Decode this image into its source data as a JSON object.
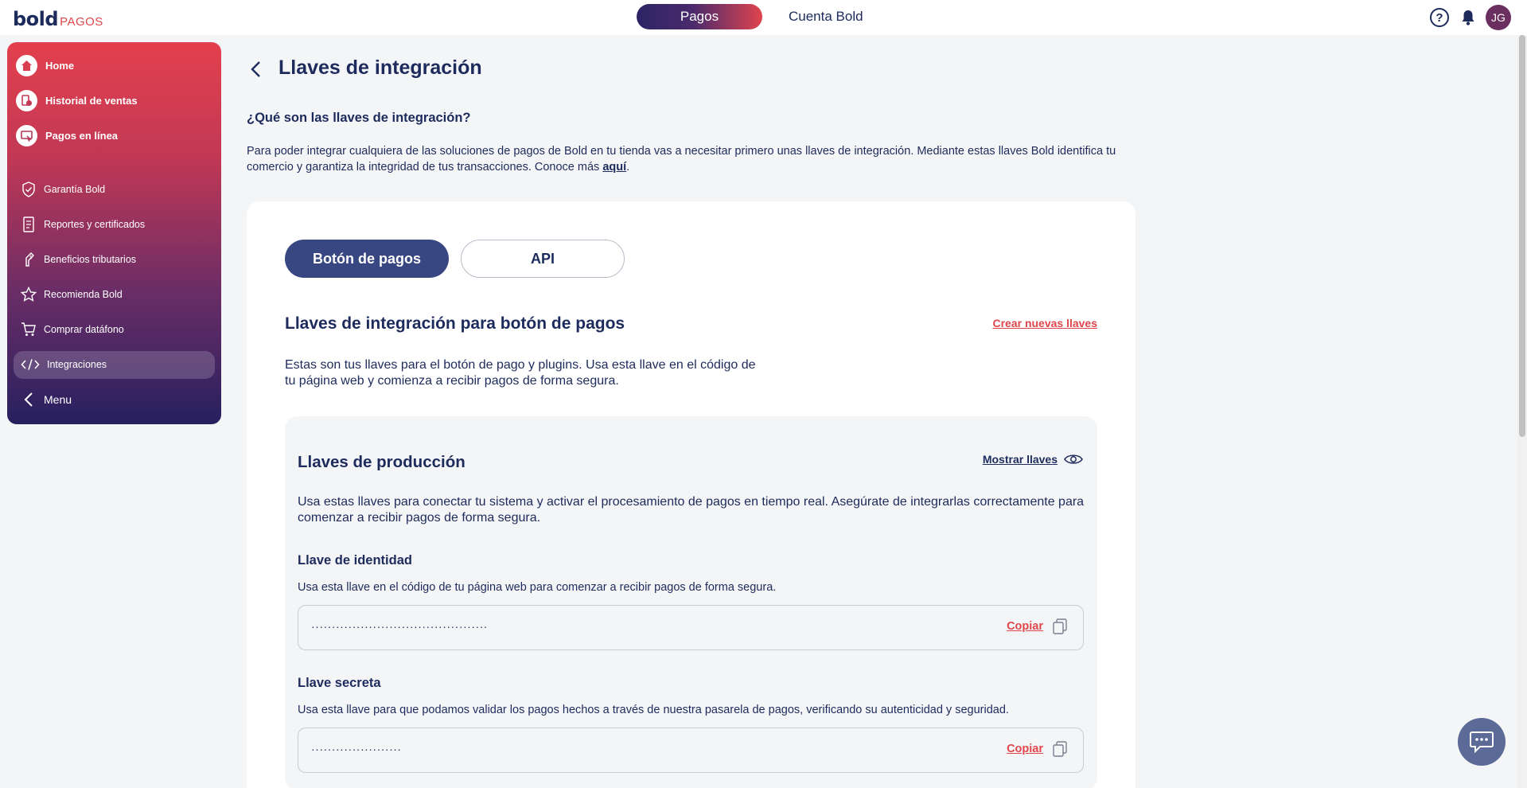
{
  "brand": {
    "logo_main": "bold",
    "logo_sub": "PAGOS"
  },
  "topnav": {
    "active": "Pagos",
    "other": "Cuenta Bold"
  },
  "user": {
    "initials": "JG"
  },
  "sidebar": {
    "main_items": [
      {
        "label": "Home",
        "icon": "home-icon"
      },
      {
        "label": "Historial de ventas",
        "icon": "history-icon"
      },
      {
        "label": "Pagos en línea",
        "icon": "online-payments-icon"
      }
    ],
    "items": [
      {
        "label": "Garantía Bold",
        "icon": "shield-icon"
      },
      {
        "label": "Reportes y certificados",
        "icon": "document-icon"
      },
      {
        "label": "Beneficios tributarios",
        "icon": "tax-icon"
      },
      {
        "label": "Recomienda Bold",
        "icon": "star-icon"
      },
      {
        "label": "Comprar datáfono",
        "icon": "cart-icon"
      },
      {
        "label": "Integraciones",
        "icon": "code-icon"
      }
    ],
    "menu_label": "Menu"
  },
  "page": {
    "title": "Llaves de integración",
    "what_title": "¿Qué son las llaves de integración?",
    "what_desc": "Para poder integrar cualquiera de las soluciones de pagos de Bold en tu tienda vas a necesitar primero unas llaves de integración. Mediante estas llaves Bold identifica tu comercio y garantiza la integridad de tus transacciones. Conoce más ",
    "what_link": "aquí",
    "what_end": "."
  },
  "tabs": {
    "active": "Botón de pagos",
    "other": "API"
  },
  "section": {
    "title": "Llaves de integración para botón de pagos",
    "create_link": "Crear nuevas llaves",
    "desc": "Estas son tus llaves para el botón de pago y plugins. Usa esta llave en el código de tu página web y comienza a recibir pagos de forma segura."
  },
  "production": {
    "title": "Llaves de producción",
    "show_link": "Mostrar llaves",
    "desc": "Usa estas llaves para conectar tu sistema y activar el procesamiento de pagos en tiempo real. Asegúrate de integrarlas correctamente para comenzar a recibir pagos de forma segura.",
    "identity": {
      "label": "Llave de identidad",
      "desc": "Usa esta llave en el código de tu página web para comenzar a recibir pagos de forma segura.",
      "value": "···········································",
      "copy": "Copiar"
    },
    "secret": {
      "label": "Llave secreta",
      "desc": "Usa esta llave para que podamos validar los pagos hechos a través de nuestra pasarela de pagos, verificando su autenticidad y seguridad.",
      "value": "······················",
      "copy": "Copiar"
    }
  }
}
